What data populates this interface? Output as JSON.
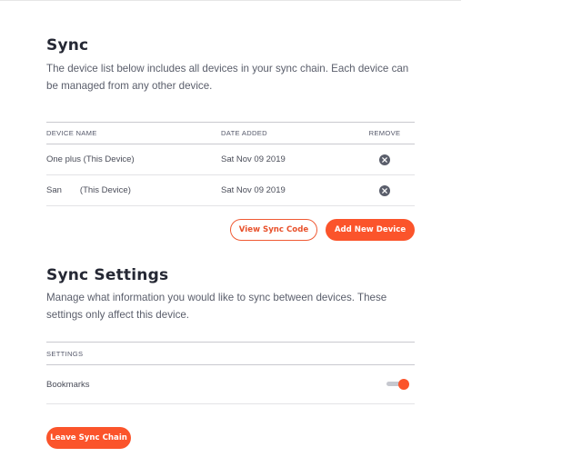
{
  "sync": {
    "title": "Sync",
    "description": "The device list below includes all devices in your sync chain. Each device can be managed from any other device.",
    "table": {
      "headers": {
        "name": "DEVICE NAME",
        "date": "DATE ADDED",
        "remove": "REMOVE"
      },
      "rows": [
        {
          "name": "One plus",
          "suffix": "(This Device)",
          "date": "Sat Nov 09 2019"
        },
        {
          "name": "San",
          "suffix": "(This Device)",
          "date": "Sat Nov 09 2019"
        }
      ]
    },
    "buttons": {
      "view_code": "View Sync Code",
      "add_device": "Add New Device"
    }
  },
  "sync_settings": {
    "title": "Sync Settings",
    "description": "Manage what information you would like to sync between devices. These settings only affect this device.",
    "table": {
      "header": "SETTINGS",
      "rows": [
        {
          "label": "Bookmarks",
          "enabled": true
        }
      ]
    },
    "leave_button": "Leave Sync Chain"
  },
  "colors": {
    "accent": "#fb542b",
    "text_dark": "#252834",
    "text_muted": "#5a5e6b"
  },
  "icons": {
    "remove": "close-circle-icon"
  }
}
